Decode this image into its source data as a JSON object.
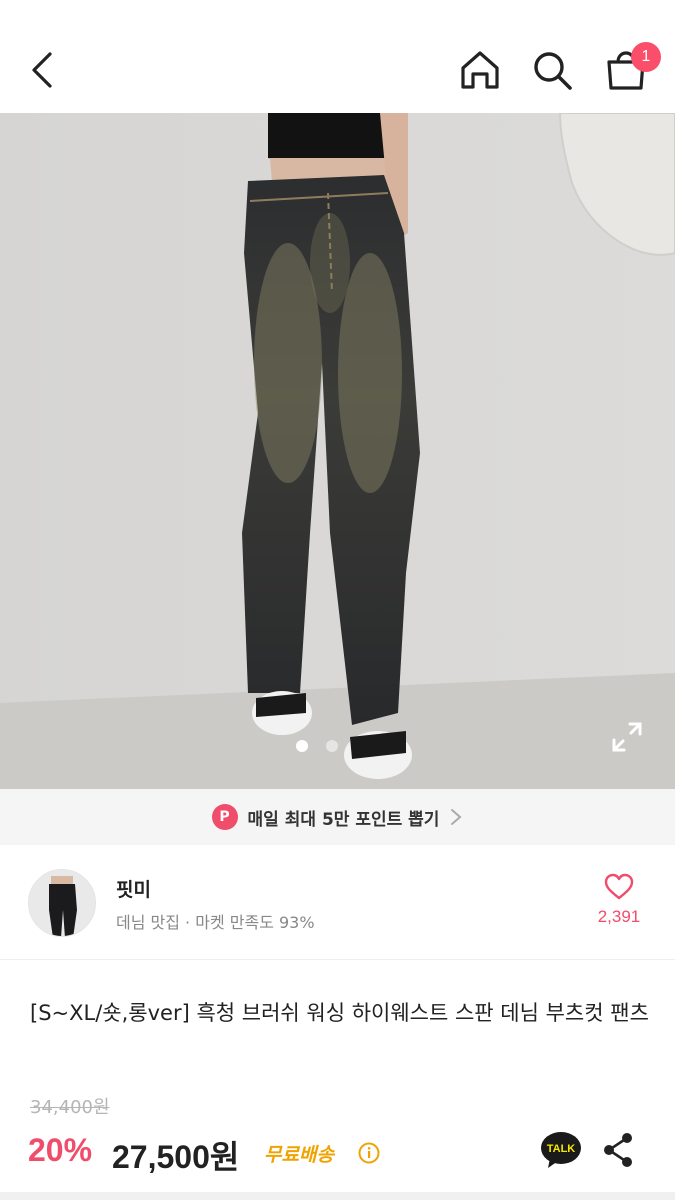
{
  "header": {
    "cart_badge": "1"
  },
  "icons": {
    "back": "chevron-left-icon",
    "home": "home-icon",
    "search": "search-icon",
    "cart": "shopping-bag-icon",
    "expand": "expand-icon",
    "heart": "heart-icon",
    "info": "info-icon",
    "talk": "kakao-talk-icon",
    "share": "share-icon"
  },
  "carousel": {
    "total_slides": 2,
    "active_slide": 1
  },
  "point_banner": {
    "badge": "P",
    "text": "매일 최대 5만 포인트 뽑기"
  },
  "shop": {
    "name": "핏미",
    "subtitle": "데님 맛집 · 마켓 만족도 93%",
    "likes": "2,391"
  },
  "product": {
    "title": "[S~XL/숏,롱ver] 흑청 브러쉬 워싱 하이웨스트 스판 데님 부츠컷 팬츠",
    "original_price": "34,400원",
    "discount": "20%",
    "price": "27,500원",
    "shipping": "무료배송",
    "talk_label": "TALK"
  },
  "colors": {
    "accent": "#f04c6b",
    "shipping": "#f0a300",
    "muted": "#b5b5b5"
  }
}
